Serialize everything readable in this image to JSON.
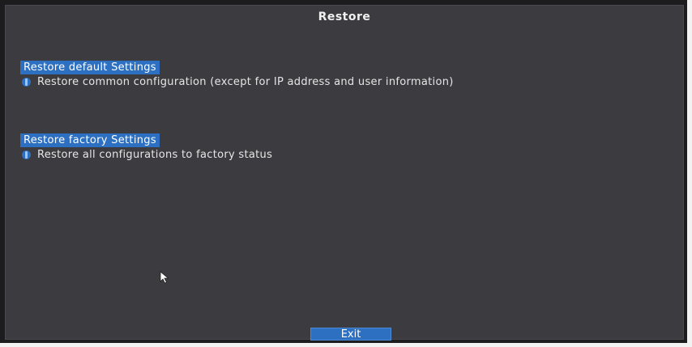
{
  "window": {
    "title": "Restore"
  },
  "sections": [
    {
      "header": "Restore default Settings",
      "option": "Restore common configuration (except for IP address and user information)"
    },
    {
      "header": "Restore factory Settings",
      "option": "Restore all configurations to factory status"
    }
  ],
  "footer": {
    "exit_label": "Exit"
  },
  "icons": {
    "option_bullet": "radio-dot-icon",
    "pointer": "mouse-cursor-icon"
  },
  "colors": {
    "accent": "#2d6fc0",
    "window_bg": "#3b3b40",
    "text": "#e6e6e6"
  }
}
